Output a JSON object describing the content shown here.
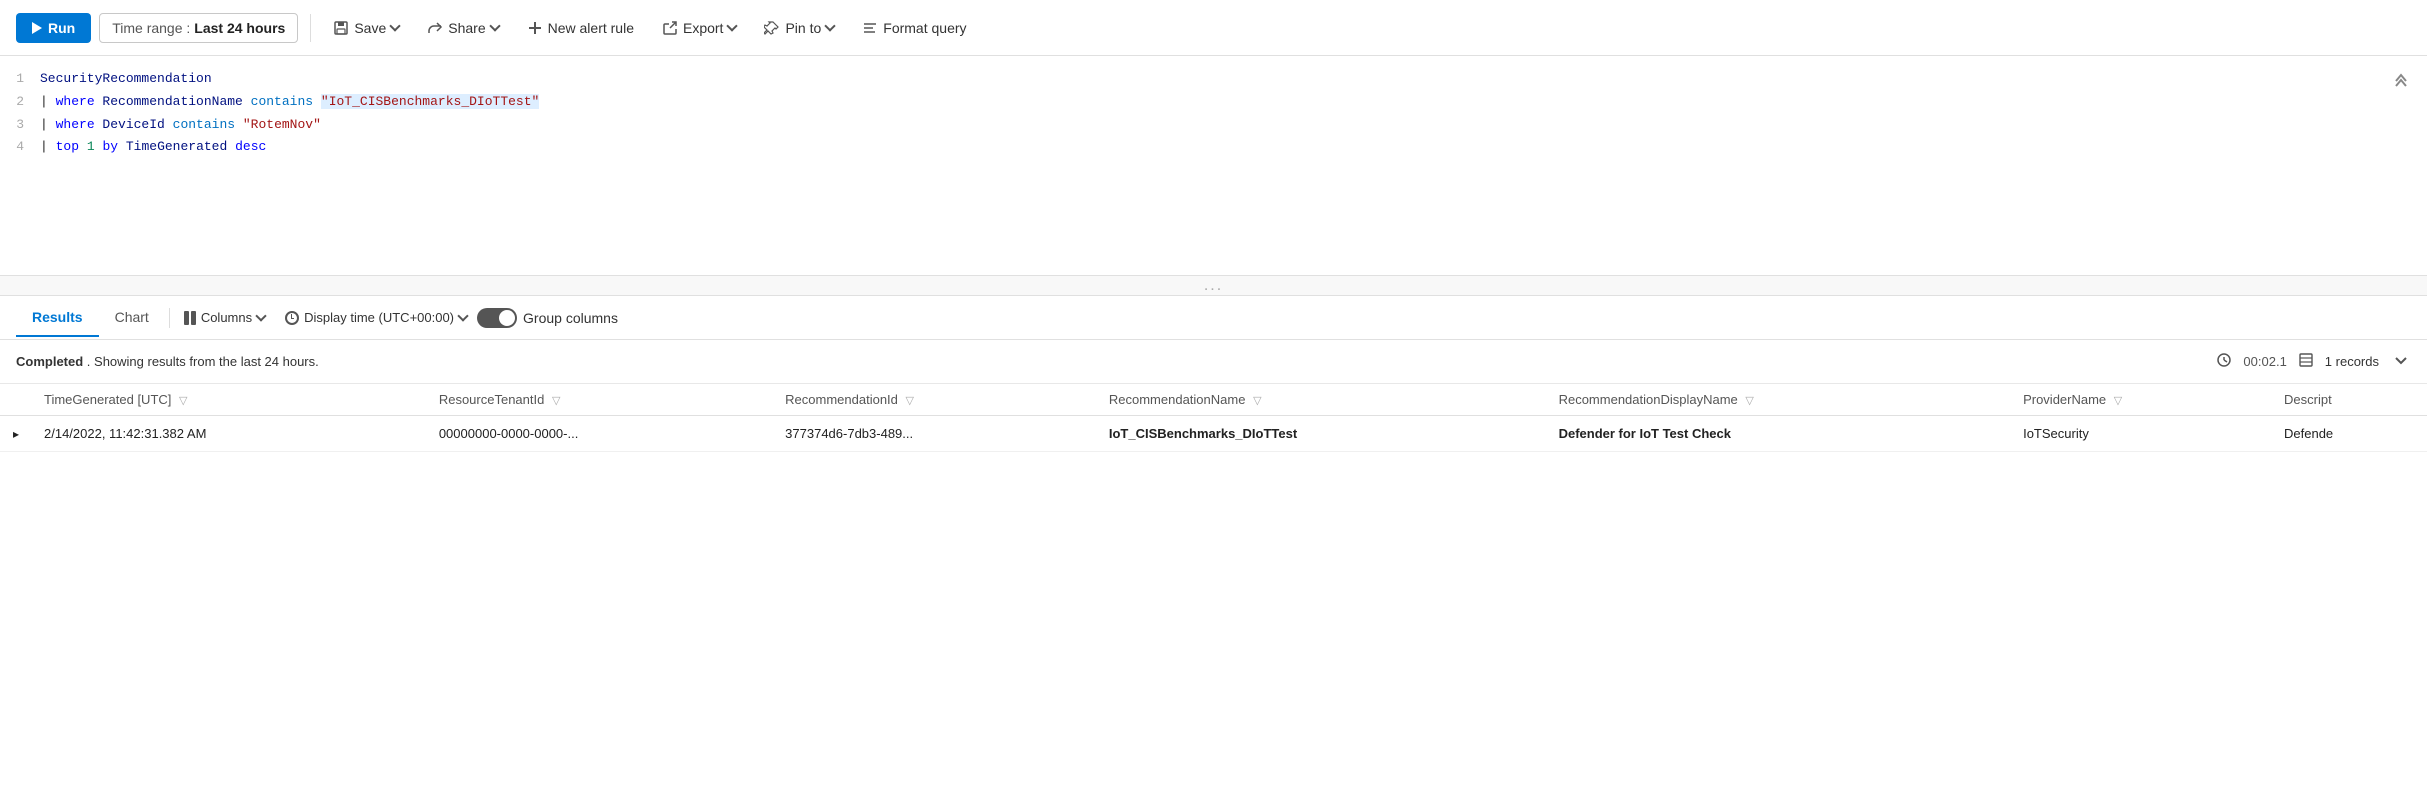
{
  "toolbar": {
    "run_label": "Run",
    "time_range_label": "Time range :",
    "time_range_value": "Last 24 hours",
    "save_label": "Save",
    "share_label": "Share",
    "new_alert_label": "New alert rule",
    "export_label": "Export",
    "pin_to_label": "Pin to",
    "format_query_label": "Format query"
  },
  "editor": {
    "lines": [
      {
        "num": "1",
        "content": "SecurityRecommendation"
      },
      {
        "num": "2",
        "content": "| where RecommendationName contains \"IoT_CISBenchmarks_DIoTTest\""
      },
      {
        "num": "3",
        "content": "| where DeviceId contains \"RotemNov\""
      },
      {
        "num": "4",
        "content": "| top 1 by TimeGenerated desc"
      }
    ]
  },
  "drag_handle": "...",
  "results": {
    "tab_results": "Results",
    "tab_chart": "Chart",
    "columns_label": "Columns",
    "display_time_label": "Display time (UTC+00:00)",
    "group_columns_label": "Group columns",
    "status_completed": "Completed",
    "status_text": ". Showing results from the last 24 hours.",
    "duration": "00:02.1",
    "records_count": "1 records",
    "columns": [
      {
        "id": "timegen",
        "label": "TimeGenerated [UTC]"
      },
      {
        "id": "resourcetenant",
        "label": "ResourceTenantId"
      },
      {
        "id": "recommendationid",
        "label": "RecommendationId"
      },
      {
        "id": "recommendationname",
        "label": "RecommendationName"
      },
      {
        "id": "recommendationdisplayname",
        "label": "RecommendationDisplayName"
      },
      {
        "id": "providername",
        "label": "ProviderName"
      },
      {
        "id": "description",
        "label": "Descript"
      }
    ],
    "rows": [
      {
        "timegen": "2/14/2022, 11:42:31.382 AM",
        "resourcetenant": "00000000-0000-0000-...",
        "recommendationid": "377374d6-7db3-489...",
        "recommendationname": "IoT_CISBenchmarks_DIoTTest",
        "recommendationdisplayname": "Defender for IoT Test Check",
        "providername": "IoTSecurity",
        "description": "Defende"
      }
    ]
  }
}
